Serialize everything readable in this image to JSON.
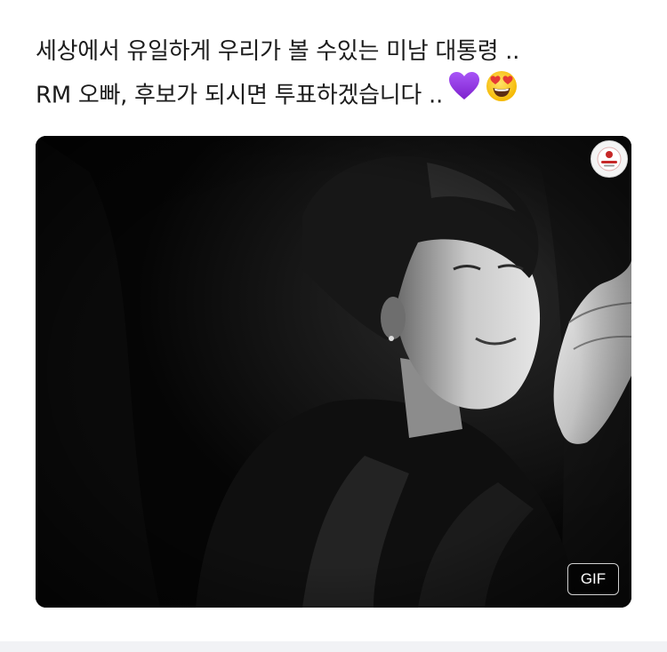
{
  "post": {
    "line1": "세상에서 유일하게 우리가 볼 수있는 미남 대통령 ..",
    "line2": "RM 오빠, 후보가 되시면 투표하겠습니다 ..",
    "emojis": [
      "purple-heart-icon",
      "heart-eyes-face-icon"
    ]
  },
  "media": {
    "type_badge": "GIF",
    "colors": {
      "purple_heart": "#8e2de2",
      "emoji_face": "#fbc02d",
      "emoji_hearts": "#e53935",
      "media_background": "#080808"
    }
  }
}
